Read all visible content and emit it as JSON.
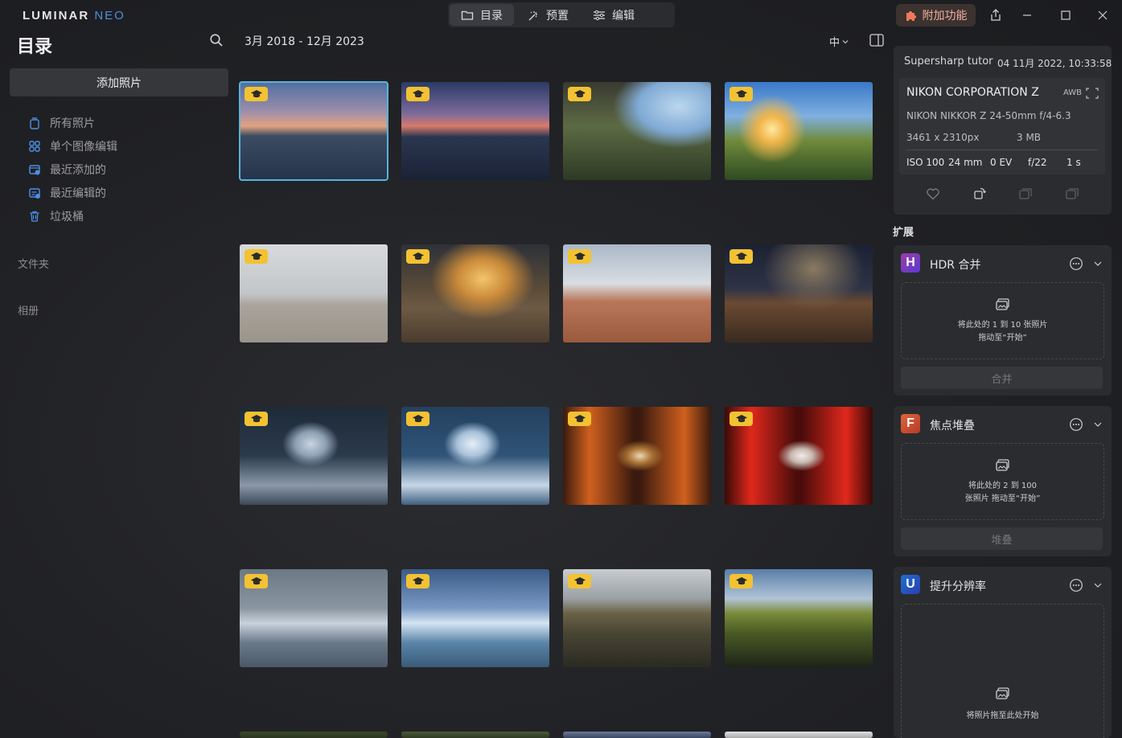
{
  "app": {
    "logo_main": "LUMINAR",
    "logo_accent": "NEO"
  },
  "modes": [
    {
      "label": "目录",
      "icon": "folder-icon"
    },
    {
      "label": "预置",
      "icon": "magic-wand-icon"
    },
    {
      "label": "编辑",
      "icon": "sliders-icon"
    }
  ],
  "header": {
    "addons_label": "附加功能"
  },
  "sidebar": {
    "title": "目录",
    "add_photos": "添加照片",
    "items": [
      {
        "label": "所有照片",
        "icon": "photos-icon"
      },
      {
        "label": "单个图像编辑",
        "icon": "grid-icon"
      },
      {
        "label": "最近添加的",
        "icon": "recently-added-icon"
      },
      {
        "label": "最近编辑的",
        "icon": "recently-edited-icon"
      },
      {
        "label": "垃圾桶",
        "icon": "trash-icon"
      }
    ],
    "folders_label": "文件夹",
    "albums_label": "相册"
  },
  "toolbar": {
    "date_range": "3月 2018 - 12月 2023",
    "thumb_size": "中"
  },
  "photos": [
    {
      "subject": "iceberg-sunset"
    },
    {
      "subject": "iceberg-dusk"
    },
    {
      "subject": "waterfall-cave"
    },
    {
      "subject": "waterfall-sunburst"
    },
    {
      "subject": "beach-grey"
    },
    {
      "subject": "beach-golden"
    },
    {
      "subject": "rock-arch-day"
    },
    {
      "subject": "rock-arch-milkyway"
    },
    {
      "subject": "ice-cave-dark"
    },
    {
      "subject": "ice-cave-bright"
    },
    {
      "subject": "torii-orange"
    },
    {
      "subject": "torii-red"
    },
    {
      "subject": "glacier-lagoon-grey"
    },
    {
      "subject": "glacier-lagoon-blue"
    },
    {
      "subject": "kirkjufell-muted"
    },
    {
      "subject": "kirkjufell-vivid"
    }
  ],
  "info": {
    "name": "Supersharp tutor",
    "date": "04 11月 2022, 10:33:58",
    "camera": "NIKON CORPORATION Z",
    "awb": "AWB",
    "lens": "NIKON NIKKOR Z 24-50mm f/4-6.3",
    "dimensions": "3461 x 2310px",
    "filesize": "3 MB",
    "iso": "ISO 100",
    "focal": "24 mm",
    "ev": "0 EV",
    "aperture": "f/22",
    "shutter": "1 s"
  },
  "extensions": {
    "heading": "扩展",
    "cards": [
      {
        "letter": "H",
        "title": "HDR 合并",
        "drop_line1": "将此处的 1 到 10 张照片",
        "drop_line2": "拖动至“开始”",
        "button": "合并"
      },
      {
        "letter": "F",
        "title": "焦点堆叠",
        "drop_line1": "将此处的 2 到 100",
        "drop_line2": "张照片 拖动至“开始”",
        "button": "堆叠"
      },
      {
        "letter": "U",
        "title": "提升分辨率",
        "drop_line1": "将照片拖至此处开始",
        "drop_line2": ""
      }
    ]
  }
}
